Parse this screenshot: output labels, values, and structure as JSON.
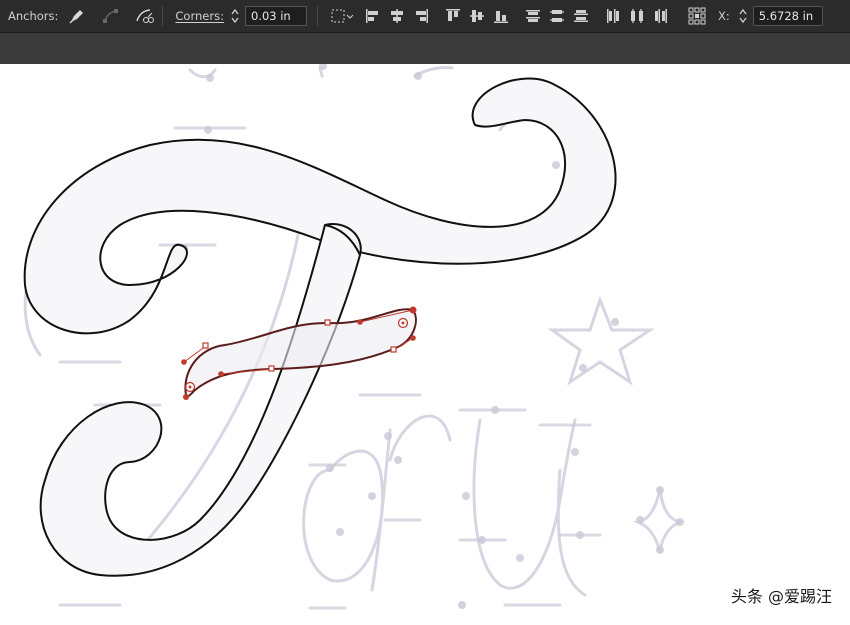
{
  "toolbar": {
    "anchors_label": "Anchors:",
    "corners_label": "Corners:",
    "corners_value": "0.03 in",
    "x_label": "X:",
    "x_value": "5.6728 in",
    "icons": {
      "convert_anchor": "pen-anchor-icon",
      "handles": "anchor-handles-icon",
      "cut_path": "cut-path-icon",
      "transform": "transform-bounds-icon",
      "align_left": "align-left-icon",
      "align_hcenter": "align-horizontal-center-icon",
      "align_right": "align-right-icon",
      "align_top": "align-top-icon",
      "align_vcenter": "align-vertical-center-icon",
      "align_bottom": "align-bottom-icon",
      "dist_top": "distribute-top-icon",
      "dist_vcenter": "distribute-vertical-center-icon",
      "dist_bottom": "distribute-bottom-icon",
      "dist_left": "distribute-left-icon",
      "dist_hcenter": "distribute-horizontal-center-icon",
      "dist_right": "distribute-right-icon",
      "reference_point": "reference-point-icon"
    }
  },
  "canvas": {
    "colors": {
      "outline": "#111111",
      "fill": "#f7f7fa",
      "sketch": "#c9c9d9",
      "selection": "#c0392b"
    }
  },
  "watermark": "头条 @爱踢汪"
}
